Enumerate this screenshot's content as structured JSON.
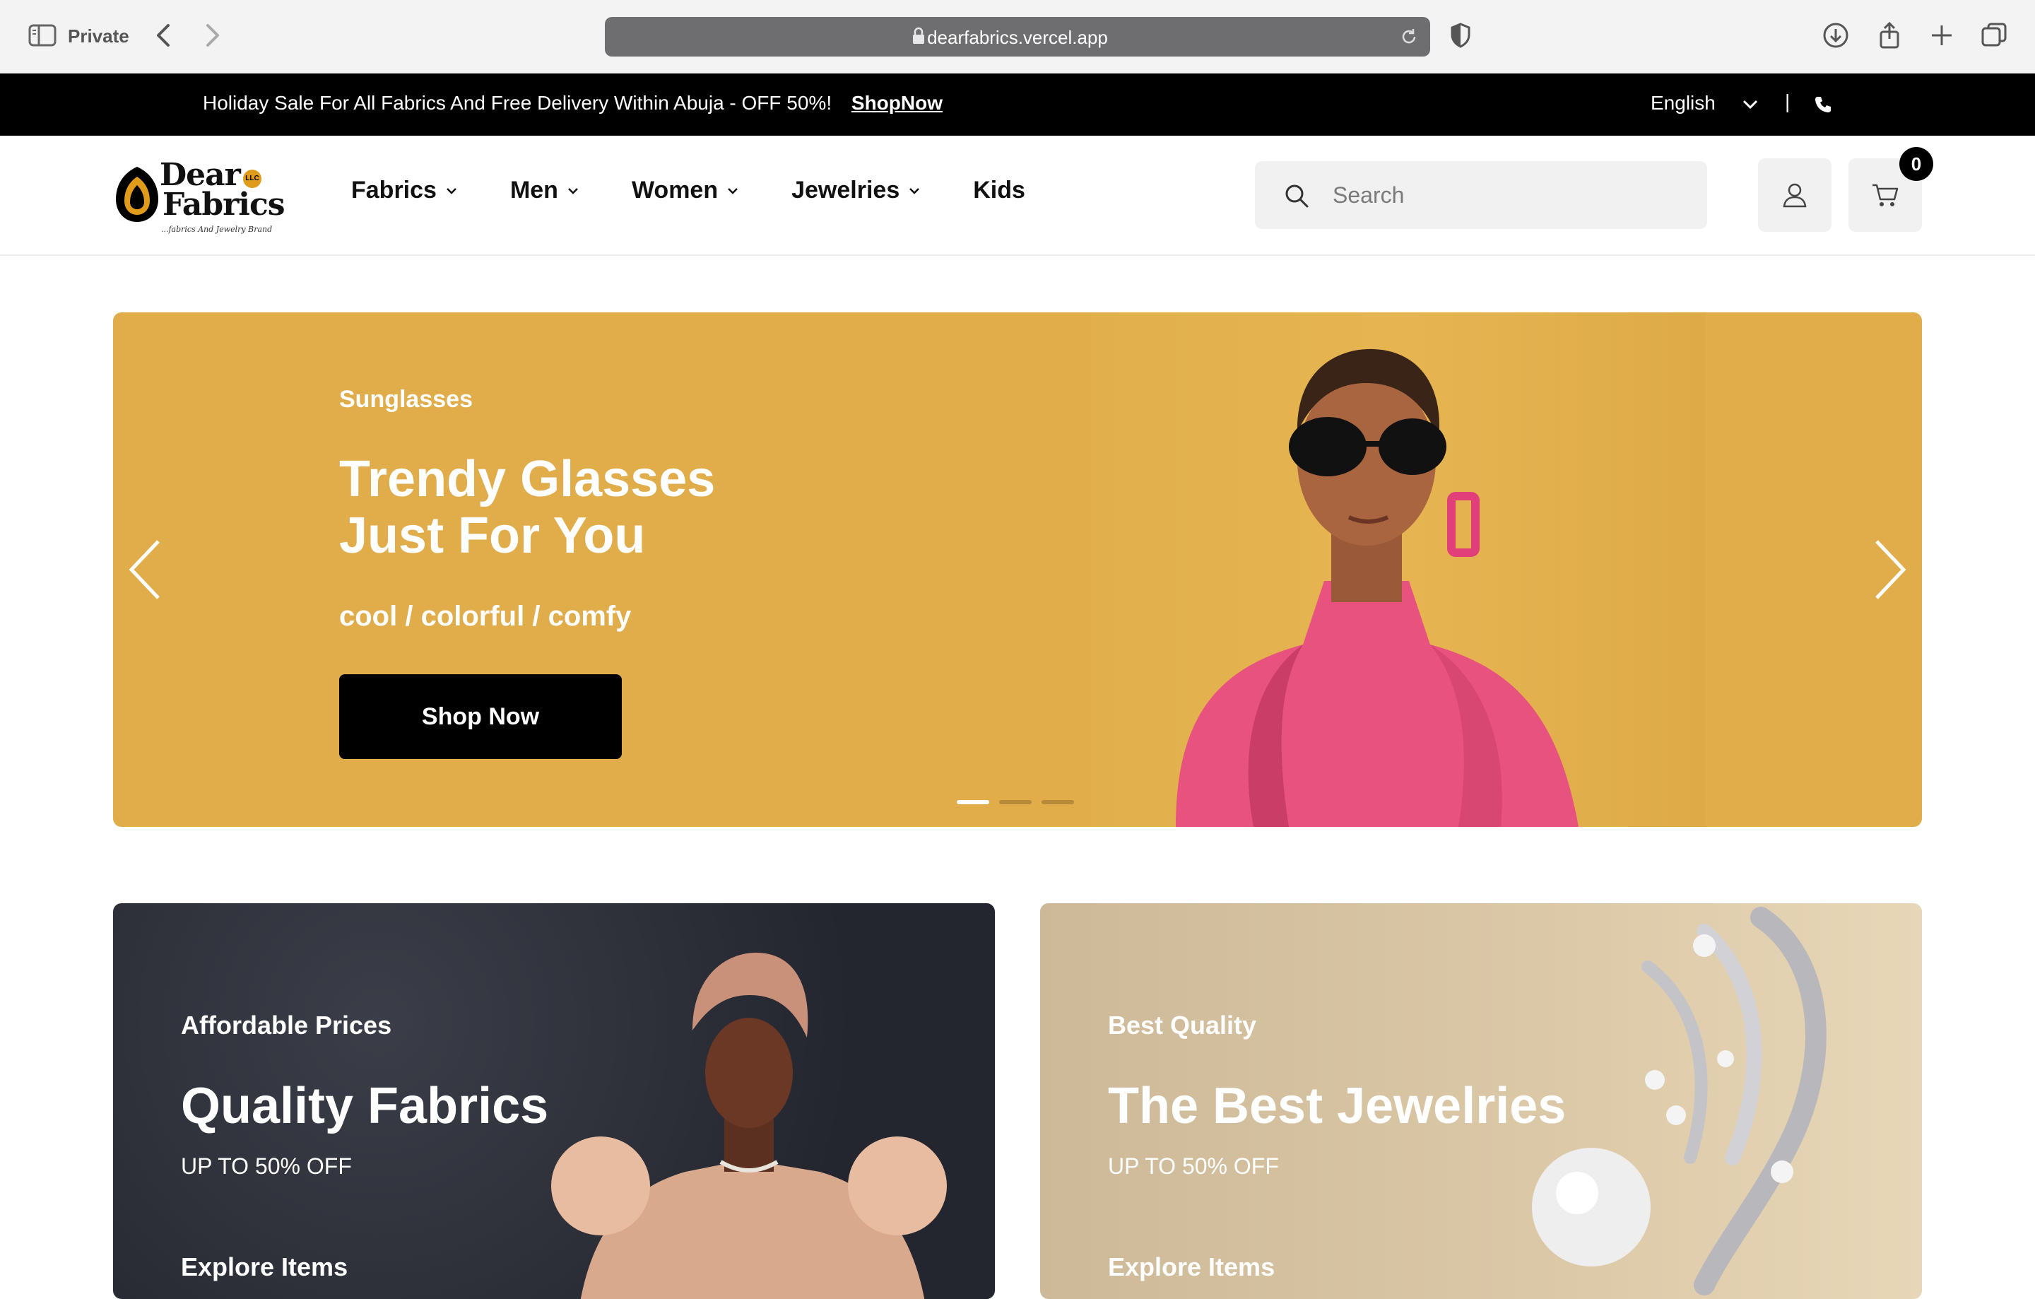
{
  "browser": {
    "private_label": "Private",
    "url": "dearfabrics.vercel.app"
  },
  "announcement": {
    "text": "Holiday Sale For All Fabrics And Free Delivery Within Abuja - OFF 50%!",
    "link": "ShopNow",
    "language": "English",
    "divider": "|"
  },
  "logo": {
    "line1": "Dear",
    "line2": "Fabrics",
    "tagline": "...fabrics And Jewelry Brand",
    "badge": "LLC"
  },
  "nav": {
    "items": [
      {
        "label": "Fabrics",
        "has_dropdown": true
      },
      {
        "label": "Men",
        "has_dropdown": true
      },
      {
        "label": "Women",
        "has_dropdown": true
      },
      {
        "label": "Jewelries",
        "has_dropdown": true
      },
      {
        "label": "Kids",
        "has_dropdown": false
      }
    ]
  },
  "search": {
    "placeholder": "Search"
  },
  "cart": {
    "count": "0"
  },
  "hero": {
    "eyebrow": "Sunglasses",
    "title_line1": "Trendy Glasses",
    "title_line2": "Just For You",
    "tagline": "cool / colorful / comfy",
    "cta": "Shop Now",
    "slides": 3,
    "active_slide": 1,
    "background": "#e0ad4a"
  },
  "promos": [
    {
      "eyebrow": "Affordable Prices",
      "title": "Quality Fabrics",
      "subtitle": "UP TO 50% OFF",
      "link": "Explore Items"
    },
    {
      "eyebrow": "Best Quality",
      "title": "The Best Jewelries",
      "subtitle": "UP TO 50% OFF",
      "link": "Explore Items"
    }
  ],
  "colors": {
    "brand_black": "#000000",
    "logo_accent": "#e09b1b",
    "hero_bg": "#e0ad4a",
    "card_dark": "#2a2c35",
    "card_light": "#d8c4a2"
  }
}
